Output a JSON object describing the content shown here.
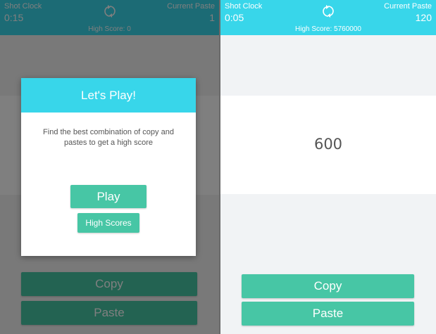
{
  "left_screen": {
    "shot_clock_label": "Shot Clock",
    "shot_clock_value": "0:15",
    "current_paste_label": "Current Paste",
    "current_paste_value": "1",
    "high_score": "High Score: 0",
    "copy_label": "Copy",
    "paste_label": "Paste",
    "dialog": {
      "title": "Let's Play!",
      "body": "Find the best combination of copy and pastes to get a high score",
      "play_label": "Play",
      "high_scores_label": "High Scores"
    }
  },
  "right_screen": {
    "shot_clock_label": "Shot Clock",
    "shot_clock_value": "0:05",
    "current_paste_label": "Current Paste",
    "current_paste_value": "120",
    "high_score": "High Score: 5760000",
    "number_display": "600",
    "copy_label": "Copy",
    "paste_label": "Paste"
  },
  "colors": {
    "accent_cyan": "#38d6ea",
    "button_green": "#47c6a5",
    "overlay": "rgba(0,0,0,0.5)"
  },
  "icons": {
    "refresh": "refresh-icon"
  }
}
